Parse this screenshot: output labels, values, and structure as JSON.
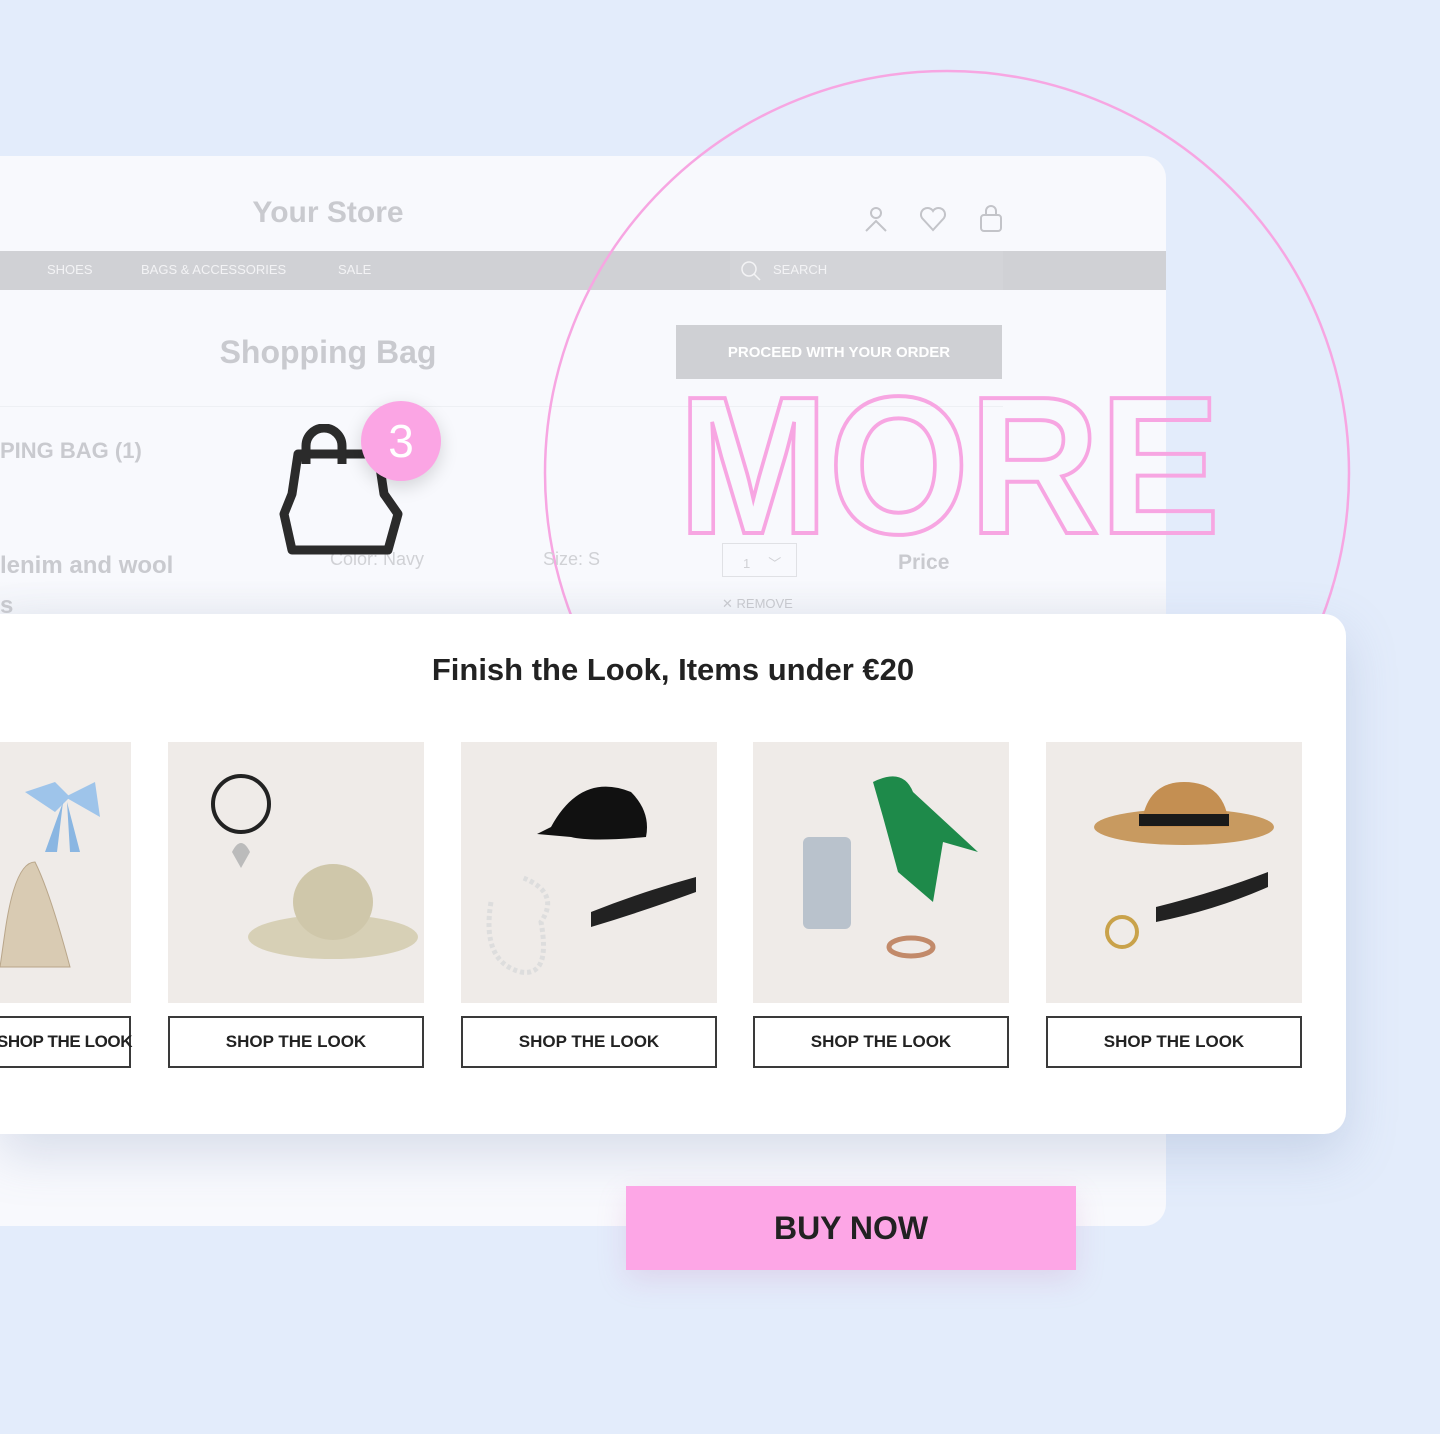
{
  "store": {
    "title": "Your Store",
    "icons": [
      "user-icon",
      "heart-icon",
      "bag-icon"
    ],
    "nav": [
      "SHOES",
      "BAGS & ACCESSORIES",
      "SALE"
    ],
    "search_placeholder": "SEARCH",
    "page_title": "Shopping Bag",
    "proceed_label": "PROCEED WITH YOUR ORDER",
    "bag_count_label": "PING BAG (1)",
    "item_name_line1": "lenim and wool",
    "item_name_line2": "s",
    "color": "Color: Navy",
    "size": "Size: S",
    "quantity": "1",
    "price_label": "Price",
    "remove_label": "REMOVE"
  },
  "overlay": {
    "word": "MORE",
    "badge_count": "3",
    "accent": "#fba5e4"
  },
  "look": {
    "title": "Finish the Look, Items under €20",
    "items": [
      {
        "button": "SHOP THE LOOK",
        "products": [
          "bow",
          "mesh bag"
        ]
      },
      {
        "button": "SHOP THE LOOK",
        "products": [
          "heart necklace",
          "straw hat"
        ]
      },
      {
        "button": "SHOP THE LOOK",
        "products": [
          "black cap",
          "pearl necklace",
          "braided belt"
        ]
      },
      {
        "button": "SHOP THE LOOK",
        "products": [
          "phone pouch",
          "green scarf",
          "ring"
        ]
      },
      {
        "button": "SHOP THE LOOK",
        "products": [
          "fedora",
          "braided belt",
          "ring"
        ]
      }
    ]
  },
  "cta": {
    "label": "BUY NOW",
    "color": "#fda6e6"
  }
}
